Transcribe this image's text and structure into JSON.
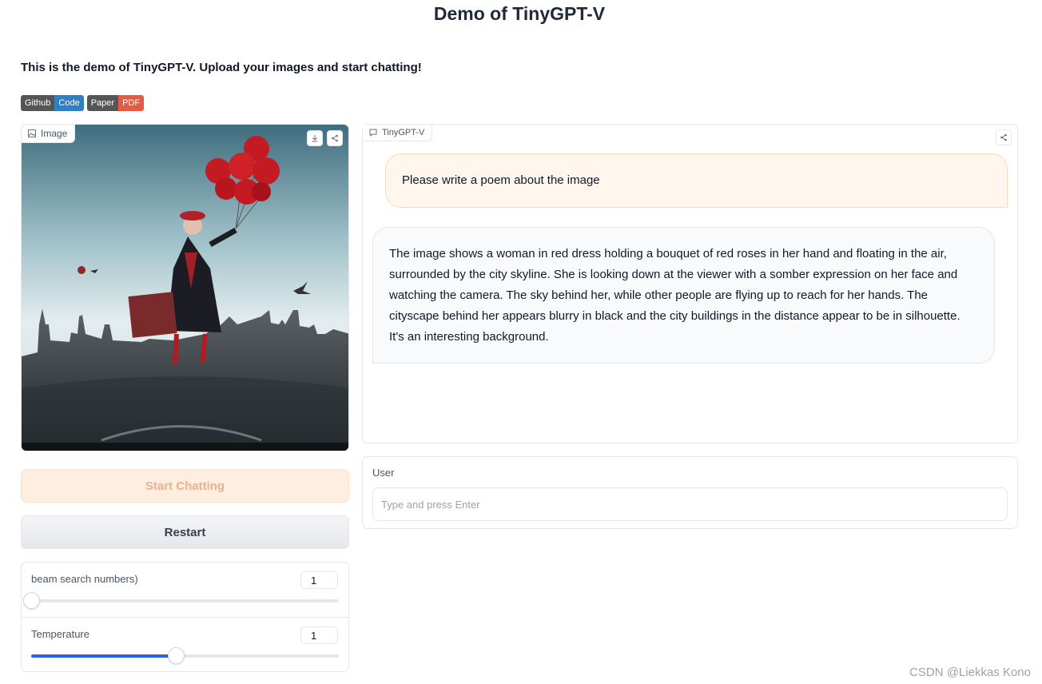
{
  "title": "Demo of TinyGPT-V",
  "description": "This is the demo of TinyGPT-V. Upload your images and start chatting!",
  "badges": [
    {
      "left": "Github",
      "right": "Code",
      "color": "#2f7fc1"
    },
    {
      "left": "Paper",
      "right": "PDF",
      "color": "#e05d44"
    }
  ],
  "image_panel": {
    "label": "Image"
  },
  "buttons": {
    "start": "Start Chatting",
    "restart": "Restart"
  },
  "sliders": [
    {
      "label": "beam search numbers)",
      "value": "1",
      "fraction": 0.0
    },
    {
      "label": "Temperature",
      "value": "1",
      "fraction": 0.47
    }
  ],
  "chat": {
    "label": "TinyGPT-V",
    "user_message": "Please write a poem about the image",
    "bot_message": "The image shows a woman in red dress holding a bouquet of red roses in her hand and floating in the air, surrounded by the city skyline. She is looking down at the viewer with a somber expression on her face and watching the camera. The sky behind her, while other people are flying up to reach for her hands. The cityscape behind her appears blurry in black and the city buildings in the distance appear to be in silhouette. It's an interesting background."
  },
  "user_input": {
    "label": "User",
    "placeholder": "Type and press Enter"
  },
  "watermark": "CSDN @Liekkas Kono",
  "colors": {
    "accent": "#2563eb",
    "start_button_bg": "#fdeee0",
    "user_bubble_bg": "#fff7ed"
  }
}
